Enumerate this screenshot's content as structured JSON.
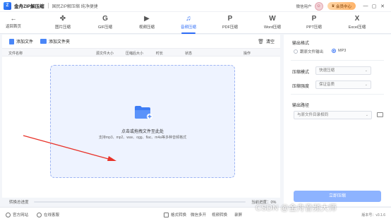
{
  "app": {
    "logo_char": "Z",
    "name": "金舟ZIP解压缩",
    "tagline": "国民ZIP解压缩 纯净便捷"
  },
  "titlebar": {
    "user_name": "微信用户",
    "vip_label": "会员中心",
    "min": "—",
    "max": "▢",
    "close": "✕"
  },
  "nav": {
    "back_label": "返回首页",
    "items": [
      {
        "label": "图片压缩",
        "icon": "✤"
      },
      {
        "label": "GIF压缩",
        "icon": "G"
      },
      {
        "label": "视频压缩",
        "icon": "▶"
      },
      {
        "label": "音频压缩",
        "icon": "♫"
      },
      {
        "label": "PDF压缩",
        "icon": "P"
      },
      {
        "label": "Word压缩",
        "icon": "W"
      },
      {
        "label": "PPT压缩",
        "icon": "P"
      },
      {
        "label": "Excel压缩",
        "icon": "X"
      }
    ],
    "active_index": 3
  },
  "toolbar": {
    "add_file": "添加文件",
    "add_folder": "添加文件夹",
    "clear": "清空"
  },
  "table": {
    "columns": [
      "文件名称",
      "源文件大小",
      "压缩后大小",
      "时长",
      "状态",
      "操作"
    ]
  },
  "dropzone": {
    "title": "点击或拖拽文件至此处",
    "formats": "支持mp3、mp2、wav、ogg、flac、m4a等多种音频格式"
  },
  "progress": {
    "label": "转换总进度",
    "value_percent": 0,
    "text": "当前进度：0%"
  },
  "settings": {
    "output_format_label": "输出格式",
    "format_options": [
      "跟原文件输出",
      "MP3"
    ],
    "format_selected": "MP3",
    "compress_mode_label": "压缩模式",
    "compress_mode_value": "快速压缩",
    "compress_level_label": "压缩强度",
    "compress_level_value": "保证音质",
    "output_path_label": "输出路径",
    "output_path_value": "与原文件目录相同",
    "start_button": "立即压缩"
  },
  "footer": {
    "items": [
      "官方网站",
      "在线客服"
    ],
    "right_items": [
      "格式转换",
      "微信多开",
      "视频转换",
      "录屏"
    ],
    "version": "版本号：v3.1.6"
  },
  "watermark": "CSDN @金舟音频大师",
  "colors": {
    "accent": "#2d6cf6",
    "dropzone_bg": "#eef3ff",
    "arrow": "#e8332a"
  }
}
